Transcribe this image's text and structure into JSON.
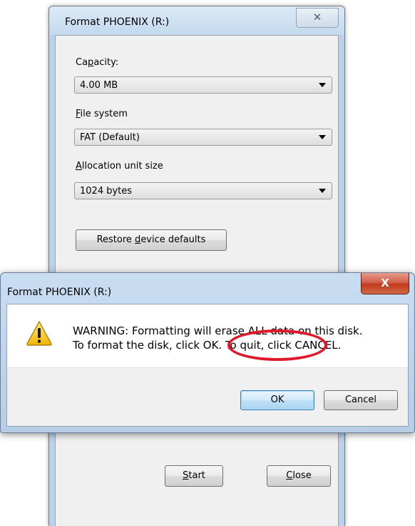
{
  "format_dialog": {
    "title": "Format PHOENIX (R:)",
    "close_glyph": "✕",
    "capacity": {
      "label_pre": "Ca",
      "label_mn": "p",
      "label_post": "acity:",
      "value": "4.00 MB"
    },
    "file_system": {
      "label_pre": "",
      "label_mn": "F",
      "label_post": "ile system",
      "value": "FAT (Default)"
    },
    "allocation": {
      "label_pre": "",
      "label_mn": "A",
      "label_post": "llocation unit size",
      "value": "1024 bytes"
    },
    "restore_button": {
      "pre": "Restore ",
      "mn": "d",
      "post": "evice defaults"
    },
    "start_button": {
      "pre": "",
      "mn": "S",
      "post": "tart"
    },
    "close_button": {
      "pre": "",
      "mn": "C",
      "post": "lose"
    }
  },
  "warning_dialog": {
    "title": "Format PHOENIX (R:)",
    "close_glyph": "X",
    "icon": "warning-icon",
    "message_line1": "WARNING: Formatting will erase ALL data on this disk.",
    "message_line2": "To format the disk, click OK. To quit, click CANCEL.",
    "ok_label": "OK",
    "cancel_label": "Cancel",
    "highlight_color": "#e0192a"
  }
}
